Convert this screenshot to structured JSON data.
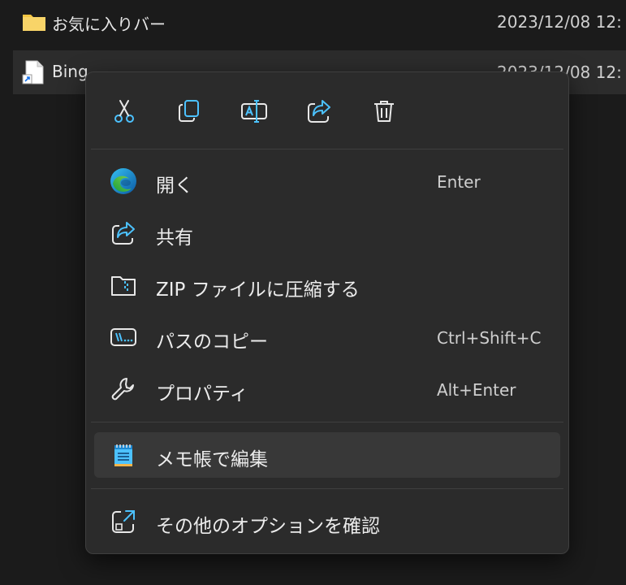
{
  "files": [
    {
      "name": "お気に入りバー",
      "date": "2023/12/08 12:",
      "icon": "folder-icon"
    },
    {
      "name": "Bing",
      "date": "2023/12/08 12:",
      "icon": "shortcut-file-icon"
    }
  ],
  "menu": {
    "quick_actions": [
      {
        "name": "cut-icon"
      },
      {
        "name": "copy-icon"
      },
      {
        "name": "rename-icon"
      },
      {
        "name": "share-icon"
      },
      {
        "name": "delete-icon"
      }
    ],
    "items": [
      {
        "label": "開く",
        "shortcut": "Enter",
        "icon": "edge-icon"
      },
      {
        "label": "共有",
        "shortcut": "",
        "icon": "share-icon"
      },
      {
        "label": "ZIP ファイルに圧縮する",
        "shortcut": "",
        "icon": "zip-folder-icon"
      },
      {
        "label": "パスのコピー",
        "shortcut": "Ctrl+Shift+C",
        "icon": "copy-path-icon"
      },
      {
        "label": "プロパティ",
        "shortcut": "Alt+Enter",
        "icon": "wrench-icon"
      },
      {
        "label": "メモ帳で編集",
        "shortcut": "",
        "icon": "notepad-icon"
      },
      {
        "label": "その他のオプションを確認",
        "shortcut": "",
        "icon": "more-options-icon"
      }
    ]
  },
  "colors": {
    "accent": "#4cc2ff",
    "menu_bg": "#2b2b2b",
    "page_bg": "#1b1b1b",
    "selected_bg": "#383838",
    "folder": "#f4c542"
  }
}
